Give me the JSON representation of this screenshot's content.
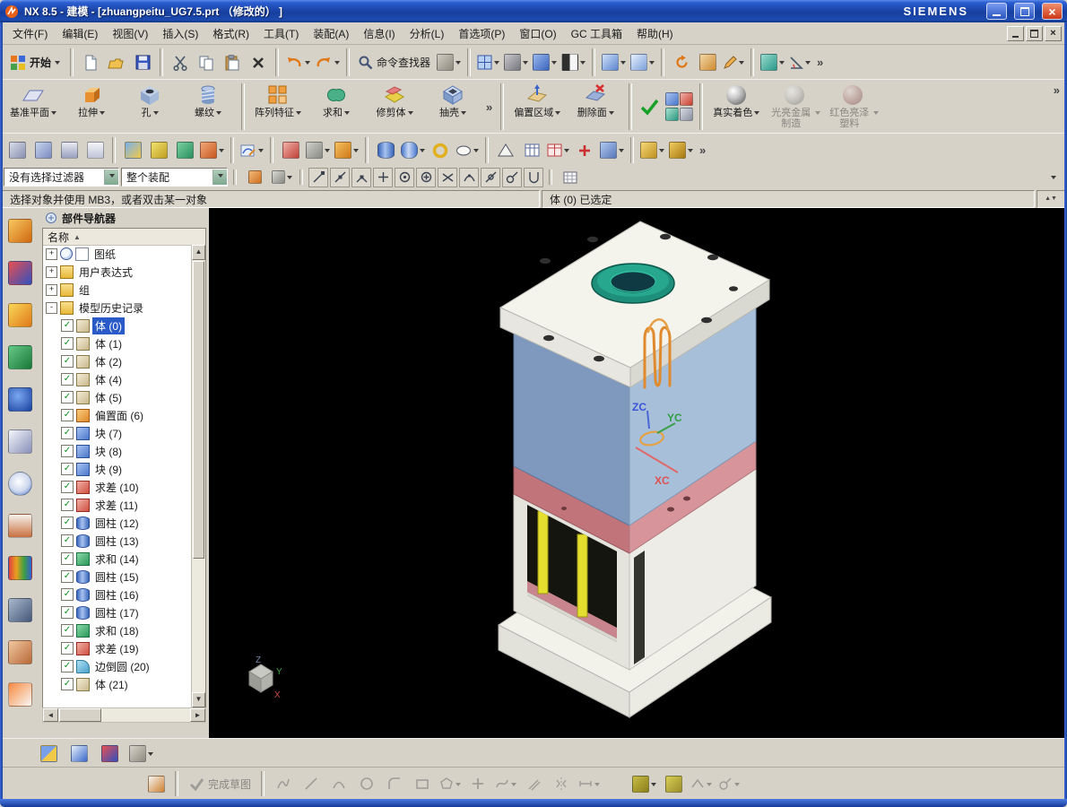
{
  "window": {
    "title": "NX 8.5 - 建模 - [zhuangpeitu_UG7.5.prt （修改的） ]",
    "brand": "SIEMENS"
  },
  "glyphs": {
    "check": "✓",
    "sort_asc": "▲",
    "up": "▲",
    "down": "▼",
    "left": "◄",
    "right": "►",
    "close": "×",
    "overflow": "»"
  },
  "menu": {
    "items": [
      {
        "label": "文件(F)"
      },
      {
        "label": "编辑(E)"
      },
      {
        "label": "视图(V)"
      },
      {
        "label": "插入(S)"
      },
      {
        "label": "格式(R)"
      },
      {
        "label": "工具(T)"
      },
      {
        "label": "装配(A)"
      },
      {
        "label": "信息(I)"
      },
      {
        "label": "分析(L)"
      },
      {
        "label": "首选项(P)"
      },
      {
        "label": "窗口(O)"
      },
      {
        "label": "GC 工具箱"
      },
      {
        "label": "帮助(H)"
      }
    ]
  },
  "toolbar1": {
    "start_label": "开始",
    "command_finder_label": "命令查找器",
    "icons": [
      "start",
      "new",
      "open",
      "save",
      "cut",
      "copy",
      "paste",
      "delete",
      "undo",
      "redo",
      "command-finder",
      "touch-mode",
      "window-layout",
      "render-style",
      "shaded-view",
      "background",
      "cascade-windows",
      "new-window",
      "refresh",
      "pencil",
      "measure-ruler",
      "angle-measure"
    ]
  },
  "features": {
    "items": [
      {
        "label": "基准平面"
      },
      {
        "label": "拉伸"
      },
      {
        "label": "孔"
      },
      {
        "label": "螺纹"
      },
      {
        "label": "阵列特征"
      },
      {
        "label": "求和"
      },
      {
        "label": "修剪体"
      },
      {
        "label": "抽壳"
      },
      {
        "label": "偏置区域"
      },
      {
        "label": "删除面"
      },
      {
        "label": "真实着色"
      },
      {
        "label": "光亮金属制造"
      },
      {
        "label": "红色亮泽塑料"
      }
    ]
  },
  "toolbar3": {
    "icons": [
      "datum-csys",
      "datum-plane",
      "layer-settings",
      "view-in-layer",
      "move-object",
      "trim",
      "transform",
      "sketch",
      "curve",
      "pencil-edit",
      "block",
      "measure",
      "cylinder",
      "tube",
      "torus",
      "ellipse",
      "triangle-mesh",
      "table",
      "red-table",
      "add-annotation",
      "face-pair",
      "tool-gold-1",
      "tool-gold-2"
    ]
  },
  "selection_bar": {
    "filter_value": "没有选择过滤器",
    "scope_value": "整个装配",
    "snap_icons": [
      "endpoint",
      "midpoint",
      "corner",
      "existing-point",
      "arc-center",
      "circle-plus",
      "intersection",
      "arc-apex",
      "point-on-curve",
      "tangent",
      "magnet"
    ]
  },
  "prompt_bar": {
    "message": "选择对象并使用 MB3，或者双击某一对象",
    "status": "体 (0) 已选定"
  },
  "resource_bar": {
    "icons": [
      "assembly-navigator",
      "constraint-navigator",
      "part-navigator",
      "reuse-library",
      "hd3d-tools",
      "web-browser",
      "history",
      "process-studio",
      "system-materials",
      "roles",
      "groups",
      "templates"
    ]
  },
  "part_navigator": {
    "title": "部件导航器",
    "name_column": "名称",
    "tree": [
      {
        "label": "图纸",
        "expand": "+"
      },
      {
        "label": "用户表达式",
        "expand": "+"
      },
      {
        "label": "组",
        "expand": "+"
      },
      {
        "label": "模型历史记录",
        "expand": "-"
      }
    ],
    "history": [
      {
        "label": "体 (0)",
        "checked": true,
        "selected": true
      },
      {
        "label": "体 (1)",
        "checked": true
      },
      {
        "label": "体 (2)",
        "checked": true
      },
      {
        "label": "体 (4)",
        "checked": true
      },
      {
        "label": "体 (5)",
        "checked": true
      },
      {
        "label": "偏置面 (6)",
        "checked": true
      },
      {
        "label": "块 (7)",
        "checked": true
      },
      {
        "label": "块 (8)",
        "checked": true
      },
      {
        "label": "块 (9)",
        "checked": true
      },
      {
        "label": "求差 (10)",
        "checked": true
      },
      {
        "label": "求差 (11)",
        "checked": true
      },
      {
        "label": "圆柱 (12)",
        "checked": true
      },
      {
        "label": "圆柱 (13)",
        "checked": true
      },
      {
        "label": "求和 (14)",
        "checked": true
      },
      {
        "label": "圆柱 (15)",
        "checked": true
      },
      {
        "label": "圆柱 (16)",
        "checked": true
      },
      {
        "label": "圆柱 (17)",
        "checked": true
      },
      {
        "label": "求和 (18)",
        "checked": true
      },
      {
        "label": "求差 (19)",
        "checked": true
      },
      {
        "label": "边倒圆 (20)",
        "checked": true
      },
      {
        "label": "体 (21)",
        "checked": true
      }
    ]
  },
  "viewport": {
    "axes": {
      "z": "ZC",
      "y": "YC",
      "x": "XC"
    },
    "triad": {
      "z": "Z",
      "y": "Y",
      "x": "X"
    }
  },
  "bottom": {
    "finish_sketch_label": "完成草图",
    "rowA_icons": [
      "window-cascade",
      "window-arrow",
      "window-close",
      "options"
    ],
    "rowB_icons": [
      "task-environment",
      "finish-sketch",
      "profile",
      "line",
      "arc",
      "circle",
      "fillet",
      "rectangle",
      "polygon",
      "point",
      "spline",
      "offset-curve",
      "mirror-curve",
      "dimension",
      "constraint-1",
      "constraint-2",
      "more-1",
      "more-2"
    ]
  }
}
